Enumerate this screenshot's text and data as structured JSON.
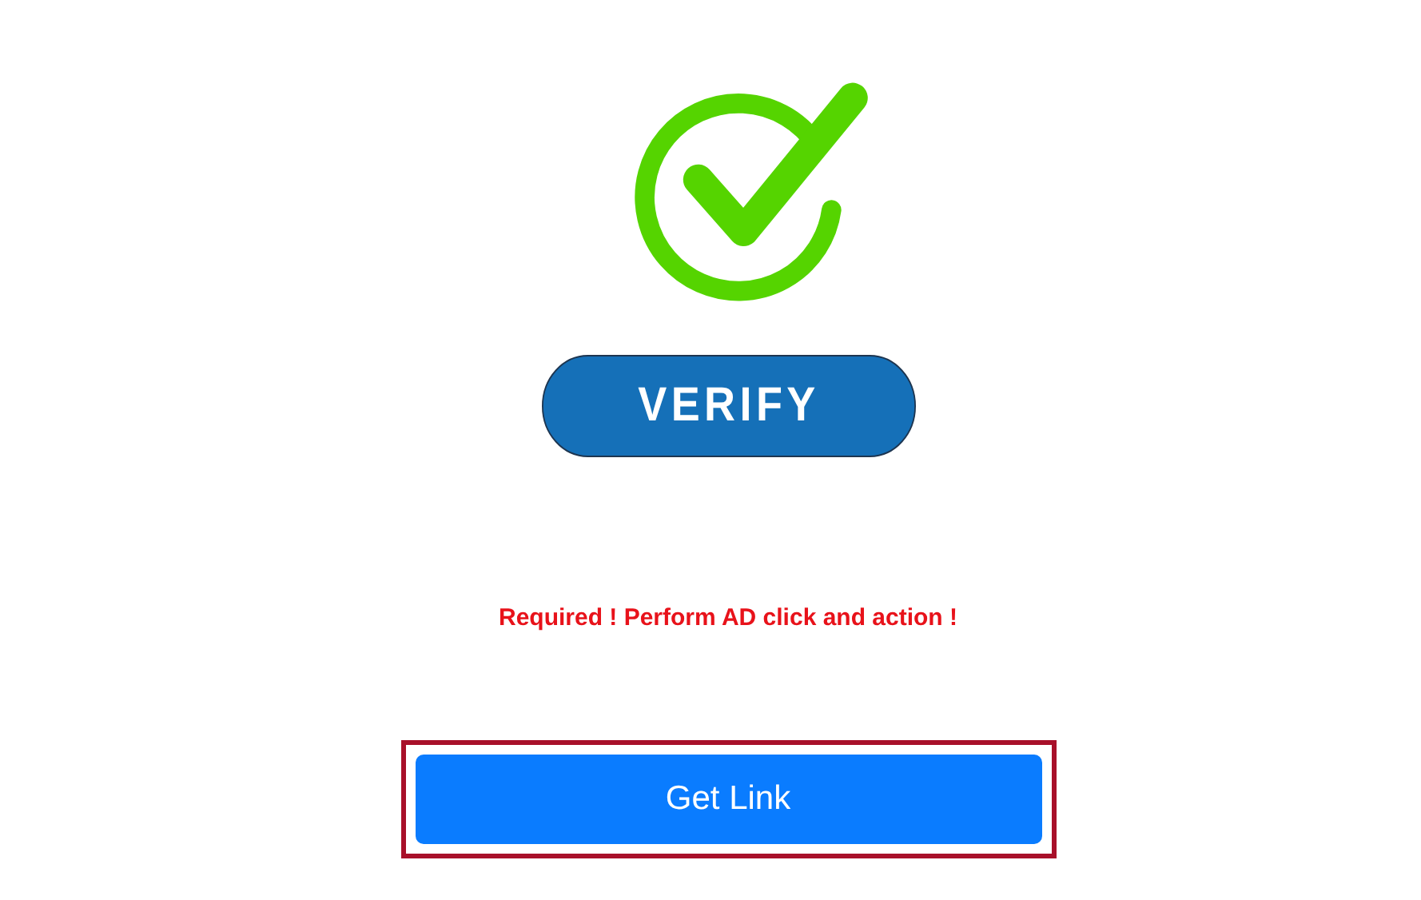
{
  "verify_button": {
    "label": "VERIFY"
  },
  "warning": {
    "text": "Required ! Perform AD click and action !"
  },
  "get_link_button": {
    "label": "Get Link",
    "highlighted": true
  }
}
